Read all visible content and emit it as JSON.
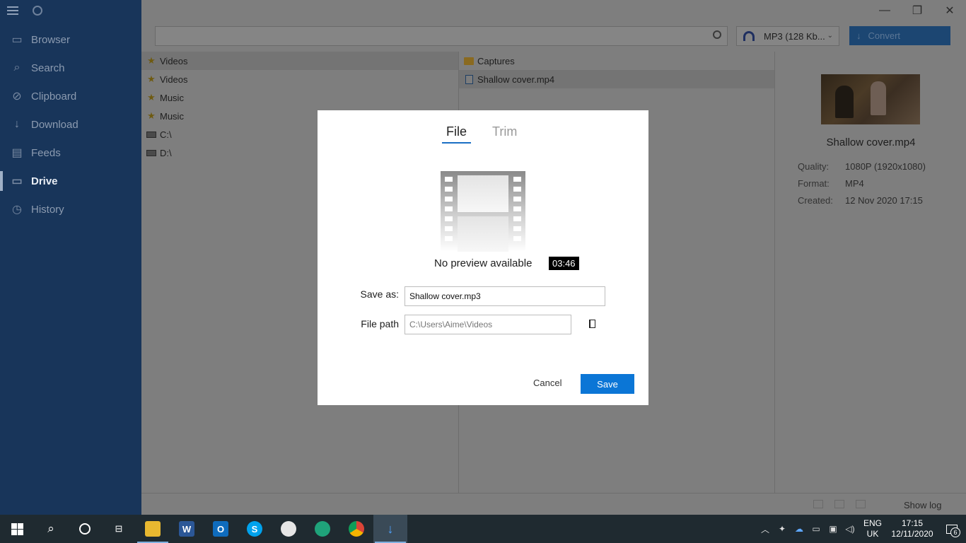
{
  "sidebar": {
    "items": [
      {
        "label": "Browser",
        "icon": "browser-icon"
      },
      {
        "label": "Search",
        "icon": "search-icon"
      },
      {
        "label": "Clipboard",
        "icon": "clipboard-icon"
      },
      {
        "label": "Download",
        "icon": "download-icon"
      },
      {
        "label": "Feeds",
        "icon": "feeds-icon"
      },
      {
        "label": "Drive",
        "icon": "folder-icon",
        "active": true
      },
      {
        "label": "History",
        "icon": "history-icon"
      }
    ]
  },
  "toolbar": {
    "search_value": "",
    "format_value": "MP3 (128 Kb...",
    "convert_label": "Convert"
  },
  "left_list": [
    {
      "label": "Videos",
      "icon": "star-icon"
    },
    {
      "label": "Videos",
      "icon": "star-icon"
    },
    {
      "label": "Music",
      "icon": "star-icon"
    },
    {
      "label": "Music",
      "icon": "star-icon"
    },
    {
      "label": "C:\\",
      "icon": "drive-icon"
    },
    {
      "label": "D:\\",
      "icon": "drive-icon"
    }
  ],
  "mid_list": [
    {
      "label": "Captures",
      "icon": "folder-icon"
    },
    {
      "label": "Shallow cover.mp4",
      "icon": "video-file-icon"
    }
  ],
  "details": {
    "title": "Shallow cover.mp4",
    "quality_label": "Quality:",
    "quality_value": "1080P (1920x1080)",
    "format_label": "Format:",
    "format_value": "MP4",
    "created_label": "Created:",
    "created_value": "12 Nov 2020 17:15"
  },
  "status": {
    "show_log": "Show log"
  },
  "dialog": {
    "tab_file": "File",
    "tab_trim": "Trim",
    "no_preview": "No preview available",
    "duration": "03:46",
    "save_as_label": "Save as:",
    "save_as_value": "Shallow cover.mp3",
    "file_path_label": "File path",
    "file_path_value": "C:\\Users\\Aime\\Videos",
    "cancel_label": "Cancel",
    "save_label": "Save"
  },
  "taskbar": {
    "lang_line1": "ENG",
    "lang_line2": "UK",
    "time": "17:15",
    "date": "12/11/2020",
    "notification_count": "6"
  },
  "colors": {
    "sidebar_bg": "#18355a",
    "accent": "#0b76d6",
    "taskbar_bg": "#1f2a30"
  }
}
